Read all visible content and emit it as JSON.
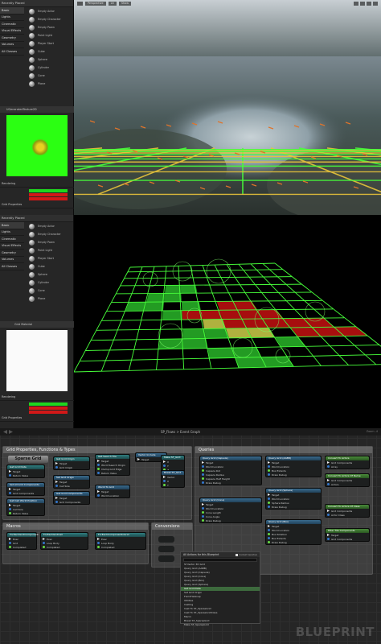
{
  "left_top": {
    "header": "Recently Placed",
    "categories": [
      "Basic",
      "Lights",
      "Cinematic",
      "Visual Effects",
      "Geometry",
      "Volumes",
      "All Classes"
    ],
    "items": [
      "Empty Actor",
      "Empty Character",
      "Empty Pawn",
      "Point Light",
      "Player Start",
      "Cube",
      "Sphere",
      "Cylinder",
      "Cone",
      "Plane"
    ],
    "texture_tab": "UGeneratedTexture2D",
    "props_title": "Rendering",
    "sub_title": "Grid Properties"
  },
  "left_bottom": {
    "header": "Recently Placed",
    "categories": [
      "Basic",
      "Lights",
      "Cinematic",
      "Visual Effects",
      "Geometry",
      "Volumes",
      "All Classes"
    ],
    "items": [
      "Empty Actor",
      "Empty Character",
      "Empty Pawn",
      "Point Light",
      "Player Start",
      "Cube",
      "Sphere",
      "Cylinder",
      "Cone",
      "Plane"
    ],
    "texture_tab": "Grid Material",
    "props_title": "Rendering",
    "sub_title": "Grid Properties"
  },
  "viewport_top": {
    "buttons": [
      "Perspective",
      "Lit",
      "Show"
    ]
  },
  "graph": {
    "breadcrumb": "SP_Flows > Event Graph",
    "zoom": "Zoom -4",
    "watermark": "BLUEPRINT",
    "comments": {
      "grid_props": "Grid Properties, Functions & Types",
      "queries": "Queries",
      "macros": "Macros",
      "conversions": "Conversions"
    },
    "sparse_grid_label": "Sparse Grid",
    "nodes": [
      {
        "title": "Get Grid Data",
        "pins": [
          "Target",
          "Return Value"
        ]
      },
      {
        "title": "Set All Grid Components",
        "pins": [
          "Target",
          "Grid Components"
        ]
      },
      {
        "title": "Get Cell World Position",
        "pins": [
          "Target",
          "Cell Size",
          "Return Value"
        ]
      },
      {
        "title": "Get Grid Origin",
        "pins": [
          "Target",
          "Grid Origin"
        ]
      },
      {
        "title": "Set Grid Origin",
        "pins": [
          "Target",
          "Cell Size"
        ]
      },
      {
        "title": "Get Grid Components",
        "pins": [
          "Target",
          "Grid Components"
        ]
      },
      {
        "title": "Get Search Tile",
        "pins": [
          "Target",
          "World Search Origin",
          "Clamp Grid Edge",
          "Return Value"
        ]
      },
      {
        "title": "World To Grid",
        "pins": [
          "Target",
          "World Location"
        ]
      },
      {
        "title": "Vector Include",
        "pins": [
          "Target"
        ]
      },
      {
        "title": "Make ST_Grid",
        "pins": [
          "X",
          "Y",
          "Z"
        ]
      },
      {
        "title": "Break ST_Grid",
        "pins": [
          "Vector",
          "X",
          "Y"
        ]
      }
    ],
    "query_nodes": [
      {
        "title": "Query Grid (Capsule)",
        "pins": [
          "Target",
          "World Location",
          "Capsule Rot",
          "Capsule Radius",
          "Capsule Half Height",
          "Draw Debug"
        ]
      },
      {
        "title": "Query Grid (AABB)",
        "pins": [
          "Target",
          "World Location",
          "Box Extents",
          "Draw Debug"
        ]
      },
      {
        "title": "Query Grid (Sphere)",
        "pins": [
          "Target",
          "World Location",
          "Sphere Radius",
          "Draw Debug"
        ]
      },
      {
        "title": "Query Grid (Cone)",
        "pins": [
          "Target",
          "World Location",
          "Cone Length",
          "Cone Angle",
          "Draw Debug"
        ]
      },
      {
        "title": "Query Grid (Box)",
        "pins": [
          "Target",
          "World Location",
          "Box Rotation",
          "Box Extents",
          "Draw Debug"
        ]
      }
    ],
    "conv_nodes": [
      {
        "title": "Convert To Actors",
        "pins": [
          "Grid Components",
          "Array"
        ]
      },
      {
        "title": "Convert To Actors Of Name",
        "pins": [
          "Grid Components",
          "Actors"
        ]
      },
      {
        "title": "Convert To Actors Of Class",
        "pins": [
          "Grid Components",
          "Actor Class"
        ]
      },
      {
        "title": "Filter Tile Components",
        "pins": [
          "Target",
          "Grid Components"
        ]
      }
    ],
    "macro_nodes": [
      {
        "title": "ForEachGridComponent",
        "pins": [
          "Exec",
          "Grid",
          "Completed"
        ]
      },
      {
        "title": "ForEachGridCell",
        "pins": [
          "Exec",
          "Loop Body",
          "Completed"
        ]
      },
      {
        "title": "ForEachComponentInGrid",
        "pins": [
          "Exec",
          "Loop Body",
          "Completed"
        ]
      }
    ],
    "context_menu": {
      "title": "All Actions for this Blueprint",
      "checkbox_label": "Context Sensitive",
      "lines": [
        "Sf Vector 3D Grid",
        "Query Grid (AABB)",
        "Query Grid (Capsule)",
        "Query Grid (Cone)",
        "Query Grid (Box)",
        "Query Grid (Sphere)",
        "Get Grid Data",
        "Set Grid Origin",
        "FGridTileSnap",
        "Utilities",
        "Casting",
        "Cast To ST_SparseGrid",
        "Cast To ST_SparseGridClass",
        "Macro",
        "Break ST_SparseGrid",
        "Make ST_SparseGrid"
      ],
      "highlight_index": 6
    }
  },
  "colors": {
    "grid_green": "#47ff3a",
    "grid_yellow": "#e8c43a",
    "cell_red": "#c41010",
    "cell_green": "#2fcf2f",
    "panel_bg": "#262626"
  }
}
